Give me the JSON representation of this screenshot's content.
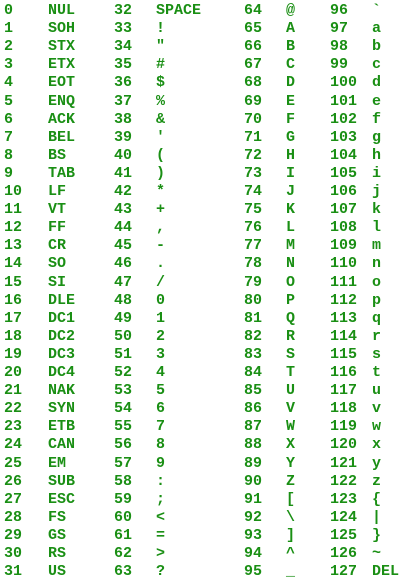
{
  "colors": {
    "text": "#1a8f14",
    "background": "#ffffff"
  },
  "rows": [
    [
      "0",
      "NUL",
      "32",
      "SPACE",
      "64",
      "@",
      "96",
      "`"
    ],
    [
      "1",
      "SOH",
      "33",
      "!",
      "65",
      "A",
      "97",
      "a"
    ],
    [
      "2",
      "STX",
      "34",
      "\"",
      "66",
      "B",
      "98",
      "b"
    ],
    [
      "3",
      "ETX",
      "35",
      "#",
      "67",
      "C",
      "99",
      "c"
    ],
    [
      "4",
      "EOT",
      "36",
      "$",
      "68",
      "D",
      "100",
      "d"
    ],
    [
      "5",
      "ENQ",
      "37",
      "%",
      "69",
      "E",
      "101",
      "e"
    ],
    [
      "6",
      "ACK",
      "38",
      "&",
      "70",
      "F",
      "102",
      "f"
    ],
    [
      "7",
      "BEL",
      "39",
      "'",
      "71",
      "G",
      "103",
      "g"
    ],
    [
      "8",
      "BS",
      "40",
      "(",
      "72",
      "H",
      "104",
      "h"
    ],
    [
      "9",
      "TAB",
      "41",
      ")",
      "73",
      "I",
      "105",
      "i"
    ],
    [
      "10",
      "LF",
      "42",
      "*",
      "74",
      "J",
      "106",
      "j"
    ],
    [
      "11",
      "VT",
      "43",
      "+",
      "75",
      "K",
      "107",
      "k"
    ],
    [
      "12",
      "FF",
      "44",
      ",",
      "76",
      "L",
      "108",
      "l"
    ],
    [
      "13",
      "CR",
      "45",
      "-",
      "77",
      "M",
      "109",
      "m"
    ],
    [
      "14",
      "SO",
      "46",
      ".",
      "78",
      "N",
      "110",
      "n"
    ],
    [
      "15",
      "SI",
      "47",
      "/",
      "79",
      "O",
      "111",
      "o"
    ],
    [
      "16",
      "DLE",
      "48",
      "0",
      "80",
      "P",
      "112",
      "p"
    ],
    [
      "17",
      "DC1",
      "49",
      "1",
      "81",
      "Q",
      "113",
      "q"
    ],
    [
      "18",
      "DC2",
      "50",
      "2",
      "82",
      "R",
      "114",
      "r"
    ],
    [
      "19",
      "DC3",
      "51",
      "3",
      "83",
      "S",
      "115",
      "s"
    ],
    [
      "20",
      "DC4",
      "52",
      "4",
      "84",
      "T",
      "116",
      "t"
    ],
    [
      "21",
      "NAK",
      "53",
      "5",
      "85",
      "U",
      "117",
      "u"
    ],
    [
      "22",
      "SYN",
      "54",
      "6",
      "86",
      "V",
      "118",
      "v"
    ],
    [
      "23",
      "ETB",
      "55",
      "7",
      "87",
      "W",
      "119",
      "w"
    ],
    [
      "24",
      "CAN",
      "56",
      "8",
      "88",
      "X",
      "120",
      "x"
    ],
    [
      "25",
      "EM",
      "57",
      "9",
      "89",
      "Y",
      "121",
      "y"
    ],
    [
      "26",
      "SUB",
      "58",
      ":",
      "90",
      "Z",
      "122",
      "z"
    ],
    [
      "27",
      "ESC",
      "59",
      ";",
      "91",
      "[",
      "123",
      "{"
    ],
    [
      "28",
      "FS",
      "60",
      "<",
      "92",
      "\\",
      "124",
      "|"
    ],
    [
      "29",
      "GS",
      "61",
      "=",
      "93",
      "]",
      "125",
      "}"
    ],
    [
      "30",
      "RS",
      "62",
      ">",
      "94",
      "^",
      "126",
      "~"
    ],
    [
      "31",
      "US",
      "63",
      "?",
      "95",
      "_",
      "127",
      "DEL"
    ]
  ]
}
